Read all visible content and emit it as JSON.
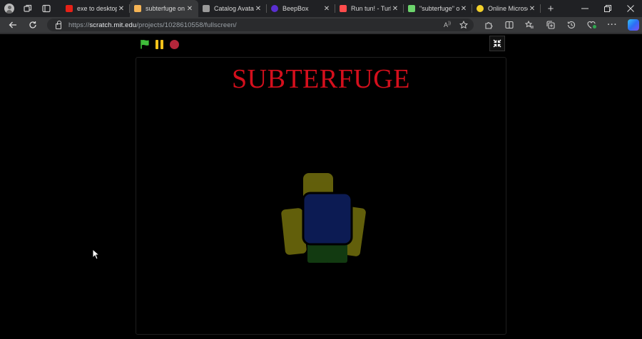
{
  "browser": {
    "tabs": [
      {
        "title": "exe to desktop",
        "favicon": "youtube-icon",
        "color": "#e62117",
        "active": false
      },
      {
        "title": "subterfuge on S",
        "favicon": "scratch-icon",
        "color": "#f5b455",
        "active": true
      },
      {
        "title": "Catalog Avatar I",
        "favicon": "roblox-icon",
        "color": "#9a9a9a",
        "active": false
      },
      {
        "title": "BeepBox",
        "favicon": "beepbox-icon",
        "color": "#5a2fd1",
        "active": false
      },
      {
        "title": "Run tun! - Turb",
        "favicon": "turbowarp-icon",
        "color": "#ff4c4c",
        "active": false
      },
      {
        "title": "\"subterfuge\" on",
        "favicon": "lightning-icon",
        "color": "#6cd46c",
        "active": false
      },
      {
        "title": "Online Microsof",
        "favicon": "smiley-icon",
        "color": "#f2d02b",
        "active": false
      }
    ],
    "url_scheme": "https://",
    "url_host": "scratch.mit.edu",
    "url_path": "/projects/1028610558/fullscreen/"
  },
  "project": {
    "stage_title": "SUBTERFUGE",
    "title_color": "#d40f1c"
  },
  "colors": {
    "flag": "#3fbd3a",
    "pause": "#f6c21a",
    "stop": "#b3263a"
  }
}
